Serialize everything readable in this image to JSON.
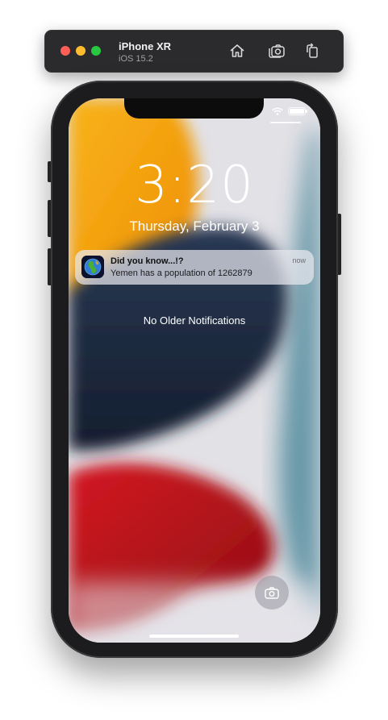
{
  "toolbar": {
    "device_name": "iPhone XR",
    "os_version": "iOS 15.2",
    "icons": [
      "home-icon",
      "screenshot-icon",
      "rotate-icon"
    ]
  },
  "lockscreen": {
    "time": "3:20",
    "date": "Thursday, February 3",
    "empty_message": "No Older Notifications",
    "icons": [
      "wifi-icon",
      "battery-icon",
      "camera-icon"
    ]
  },
  "notification": {
    "title": "Did you know...!?",
    "body": "Yemen has a population of 1262879",
    "time": "now",
    "icon": "globe-app-icon"
  },
  "colors": {
    "close": "#ff5f57",
    "minimize": "#febc2e",
    "zoom": "#28c840",
    "wallpaper_orange": "#f5a20a",
    "wallpaper_navy": "#1e2c45",
    "wallpaper_red": "#c2121b",
    "wallpaper_teal": "#3c7f93"
  }
}
